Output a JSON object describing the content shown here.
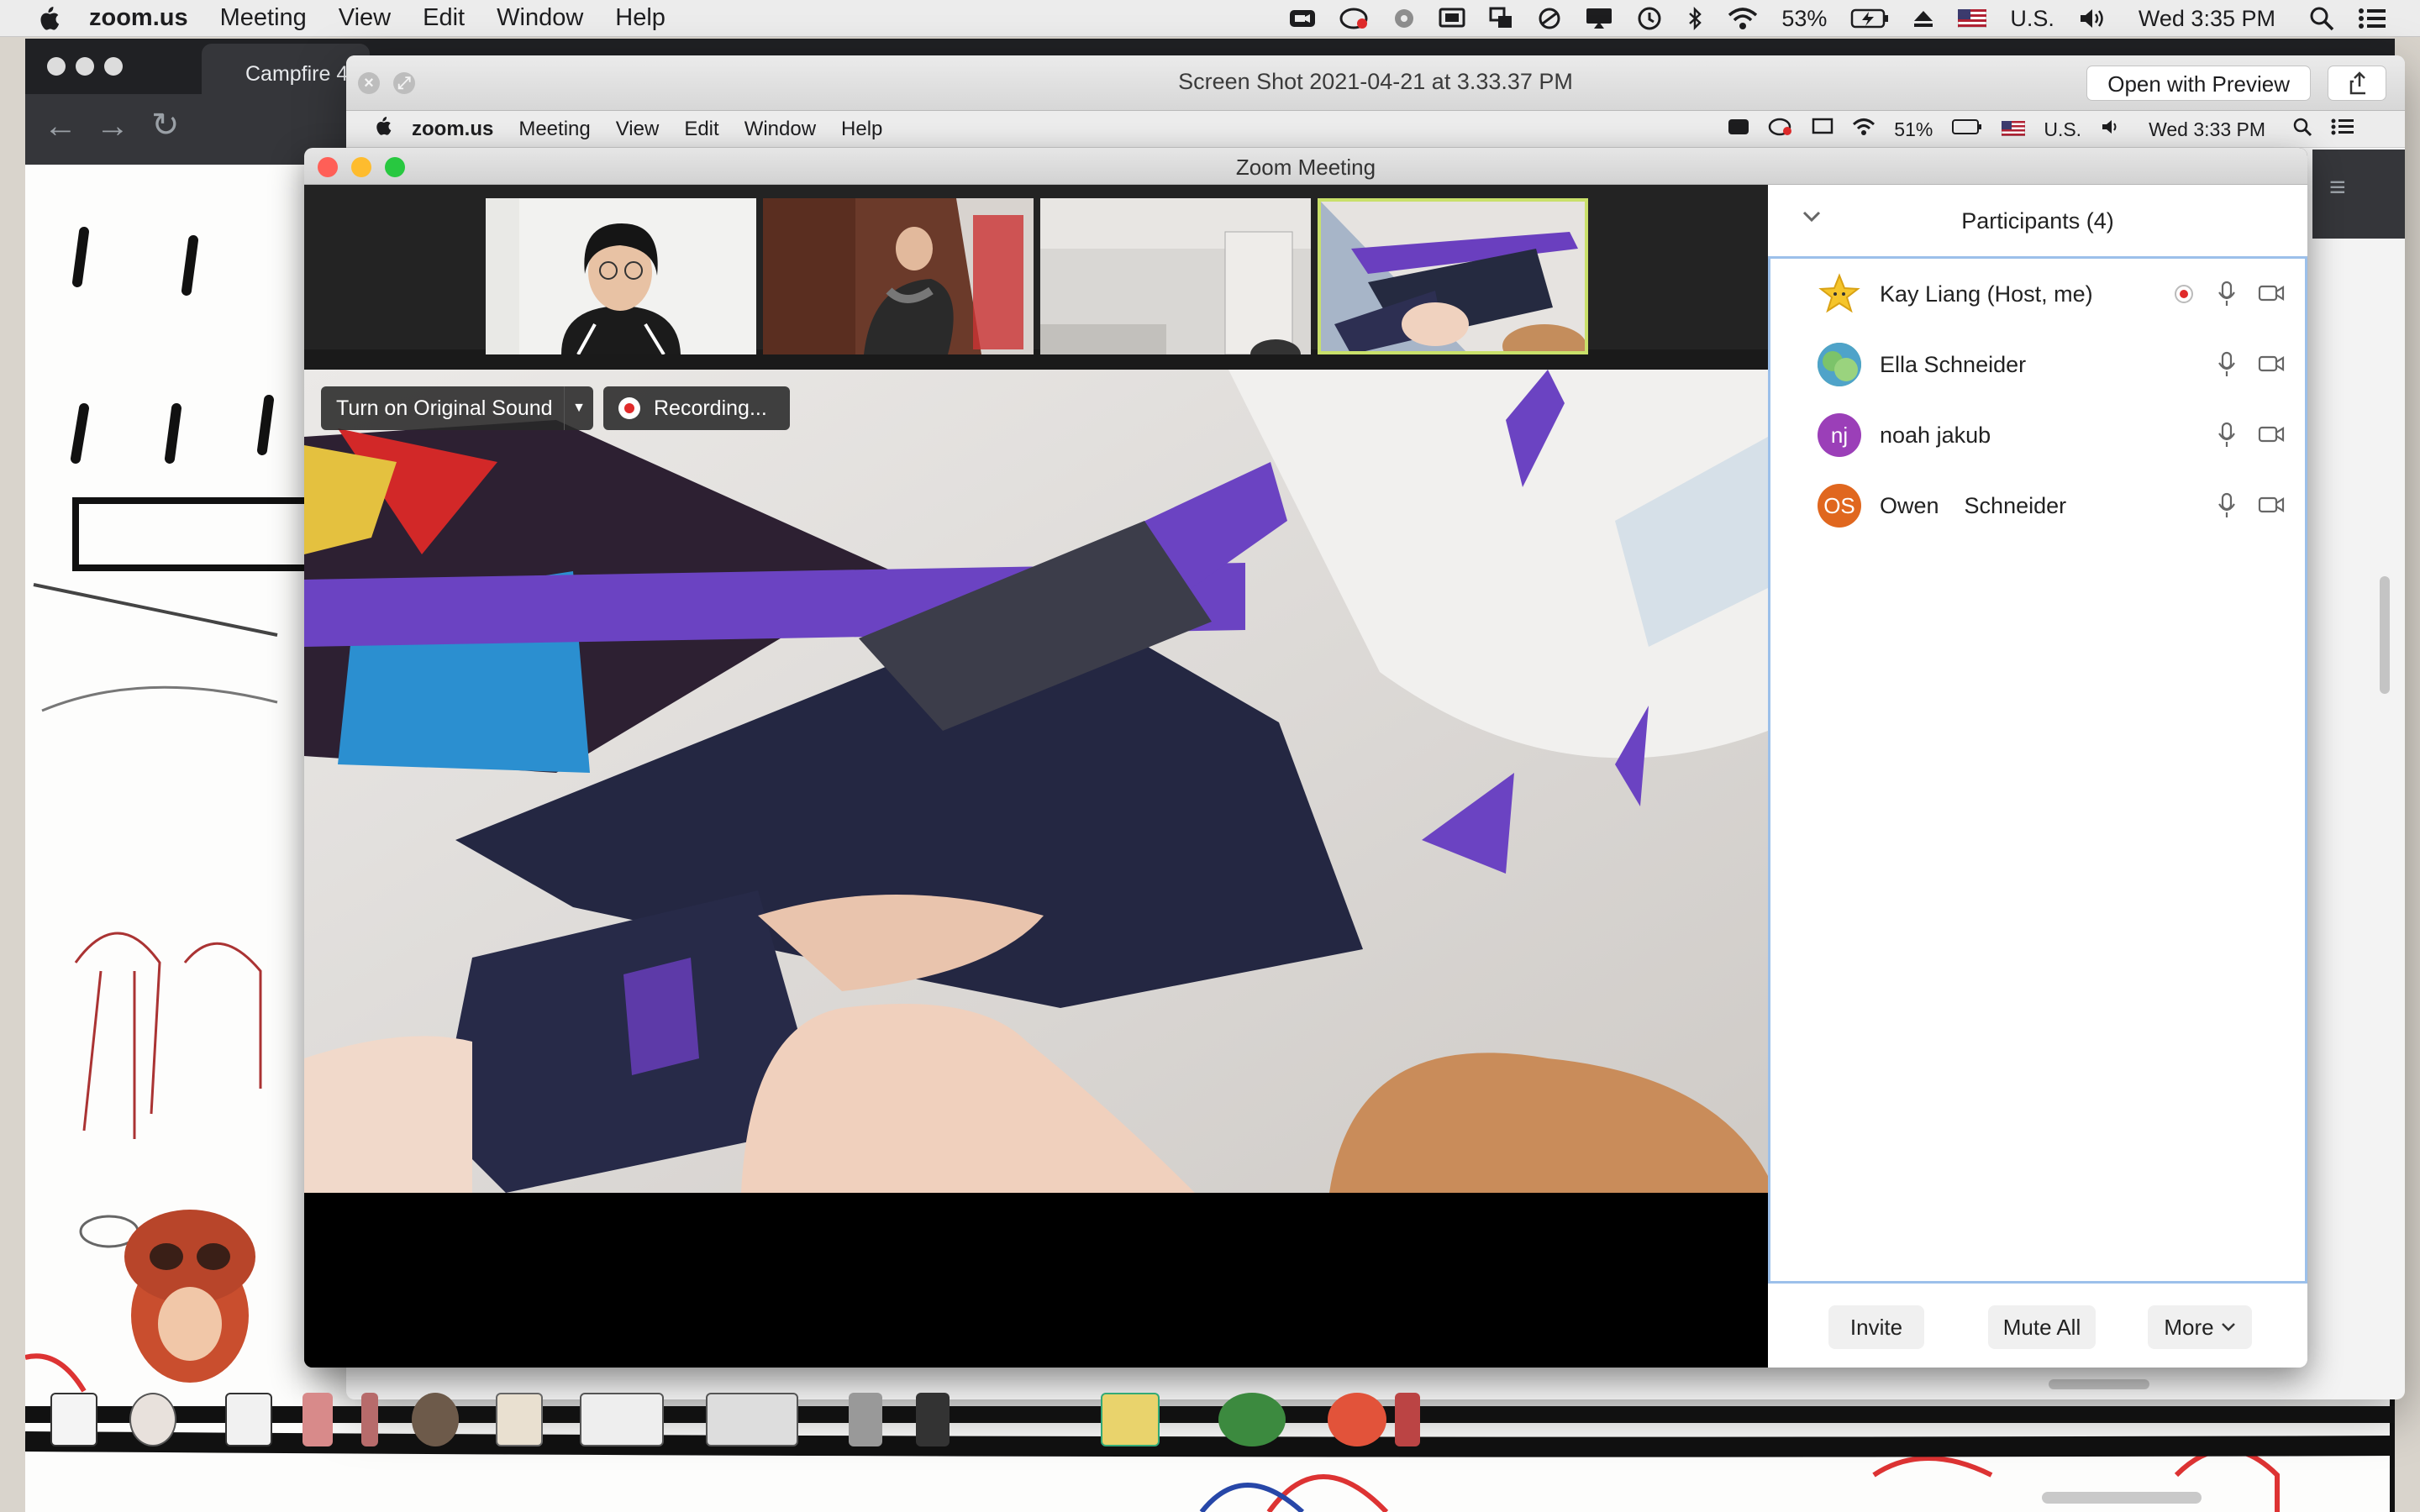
{
  "menubar": {
    "app": "zoom.us",
    "items": [
      "Meeting",
      "View",
      "Edit",
      "Window",
      "Help"
    ],
    "battery": "53%",
    "input_source": "U.S.",
    "clock": "Wed 3:35 PM"
  },
  "browser": {
    "tab_title": "Campfire 4"
  },
  "preview": {
    "title": "Screen Shot 2021-04-21 at 3.33.37 PM",
    "open_button": "Open with Preview"
  },
  "inner_menubar": {
    "app": "zoom.us",
    "items": [
      "Meeting",
      "View",
      "Edit",
      "Window",
      "Help"
    ],
    "battery": "51%",
    "input_source": "U.S.",
    "clock": "Wed 3:33 PM"
  },
  "zoom": {
    "title": "Zoom Meeting",
    "original_sound": "Turn on Original Sound",
    "recording": "Recording...",
    "panel_title": "Participants (4)",
    "participants": [
      {
        "name": "Kay Liang (Host, me)",
        "initials": "",
        "avatar": "star"
      },
      {
        "name": "Ella Schneider",
        "initials": "",
        "avatar": "photo"
      },
      {
        "name": "noah jakub",
        "initials": "nj",
        "avatar": "purple"
      },
      {
        "name": "Owen    Schneider",
        "initials": "OS",
        "avatar": "orange"
      }
    ],
    "buttons": {
      "invite": "Invite",
      "mute_all": "Mute All",
      "more": "More"
    }
  },
  "colors": {
    "zoom_blue": "#9cc0ea",
    "record_red": "#e02b2b",
    "avatar_purple": "#9b3fb8",
    "avatar_orange": "#e0671f",
    "active_thumb": "#c9e06a"
  }
}
